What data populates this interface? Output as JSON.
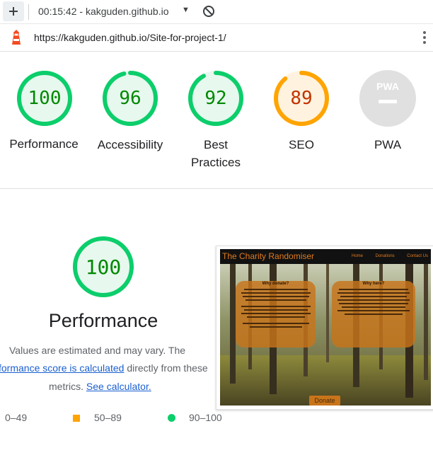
{
  "tab": {
    "title": "00:15:42 - kakguden.github.io"
  },
  "address_bar": {
    "url": "https://kakguden.github.io/Site-for-project-1/"
  },
  "scores": [
    {
      "value": "100",
      "label": "Performance",
      "fraction": 1.0,
      "status": "pass"
    },
    {
      "value": "96",
      "label": "Accessibility",
      "fraction": 0.96,
      "status": "pass"
    },
    {
      "value": "92",
      "label_line1": "Best",
      "label_line2": "Practices",
      "fraction": 0.92,
      "status": "pass"
    },
    {
      "value": "89",
      "label": "SEO",
      "fraction": 0.89,
      "status": "average"
    },
    {
      "badge": "PWA",
      "label": "PWA",
      "status": "na"
    }
  ],
  "performance": {
    "score": "100",
    "title": "Performance",
    "line1": "Values are estimated and may vary. The",
    "link1": "formance score is calculated",
    "line2_rest": "directly from these",
    "line3_pre": "metrics.",
    "link2": "See calculator."
  },
  "screenshot": {
    "site_title": "The Charity Randomiser",
    "nav": [
      "Home",
      "Donations",
      "Contact Us"
    ],
    "card_left_heading": "Why donate?",
    "card_right_heading": "Why here?",
    "donate_button": "Donate"
  },
  "legend": {
    "fail": "0–49",
    "average": "50–89",
    "pass": "90–100"
  },
  "colors": {
    "pass": "#0cce6b",
    "average": "#ffa400",
    "fail": "#ff4e42",
    "pass_text": "#008800",
    "average_text": "#c33300",
    "na": "#e0e0e0"
  }
}
